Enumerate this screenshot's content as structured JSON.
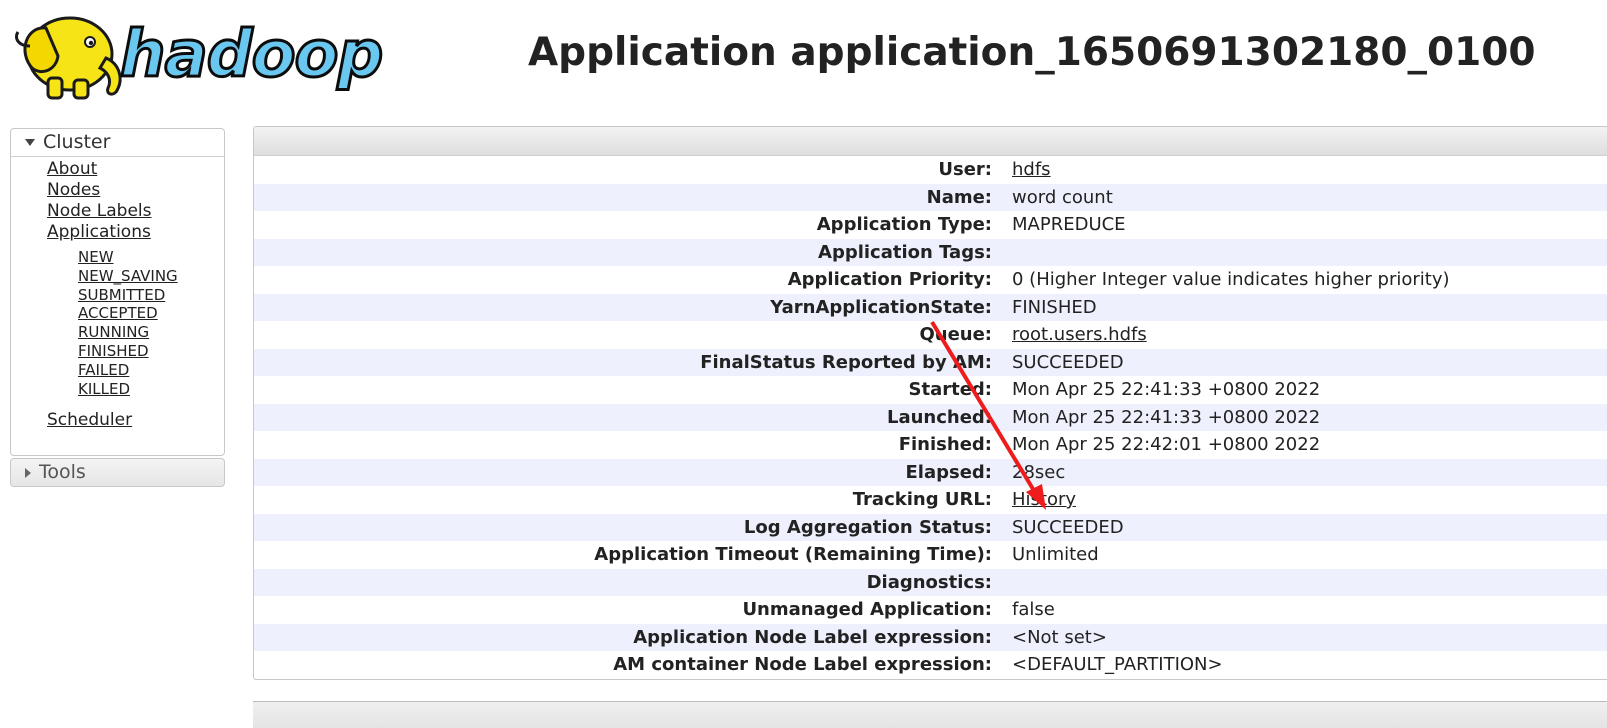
{
  "header": {
    "logo_text": "hadoop",
    "page_title": "Application application_1650691302180_0100"
  },
  "sidebar": {
    "cluster": {
      "label": "Cluster",
      "links": [
        "About",
        "Nodes",
        "Node Labels",
        "Applications"
      ],
      "app_states": [
        "NEW",
        "NEW_SAVING",
        "SUBMITTED",
        "ACCEPTED",
        "RUNNING",
        "FINISHED",
        "FAILED",
        "KILLED"
      ],
      "scheduler": "Scheduler"
    },
    "tools": {
      "label": "Tools"
    }
  },
  "app_info": [
    {
      "label": "User:",
      "value": "hdfs",
      "link": true
    },
    {
      "label": "Name:",
      "value": "word count",
      "link": false
    },
    {
      "label": "Application Type:",
      "value": "MAPREDUCE",
      "link": false
    },
    {
      "label": "Application Tags:",
      "value": "",
      "link": false
    },
    {
      "label": "Application Priority:",
      "value": "0 (Higher Integer value indicates higher priority)",
      "link": false
    },
    {
      "label": "YarnApplicationState:",
      "value": "FINISHED",
      "link": false
    },
    {
      "label": "Queue:",
      "value": "root.users.hdfs",
      "link": true
    },
    {
      "label": "FinalStatus Reported by AM:",
      "value": "SUCCEEDED",
      "link": false
    },
    {
      "label": "Started:",
      "value": "Mon Apr 25 22:41:33 +0800 2022",
      "link": false
    },
    {
      "label": "Launched:",
      "value": "Mon Apr 25 22:41:33 +0800 2022",
      "link": false
    },
    {
      "label": "Finished:",
      "value": "Mon Apr 25 22:42:01 +0800 2022",
      "link": false
    },
    {
      "label": "Elapsed:",
      "value": "28sec",
      "link": false
    },
    {
      "label": "Tracking URL:",
      "value": "History",
      "link": true
    },
    {
      "label": "Log Aggregation Status:",
      "value": "SUCCEEDED",
      "link": false
    },
    {
      "label": "Application Timeout (Remaining Time):",
      "value": "Unlimited",
      "link": false
    },
    {
      "label": "Diagnostics:",
      "value": "",
      "link": false
    },
    {
      "label": "Unmanaged Application:",
      "value": "false",
      "link": false
    },
    {
      "label": "Application Node Label expression:",
      "value": "<Not set>",
      "link": false
    },
    {
      "label": "AM container Node Label expression:",
      "value": "<DEFAULT_PARTITION>",
      "link": false
    }
  ],
  "annotation": {
    "arrow_color": "#ee1c1c",
    "logo_yellow": "#f5e21b"
  }
}
